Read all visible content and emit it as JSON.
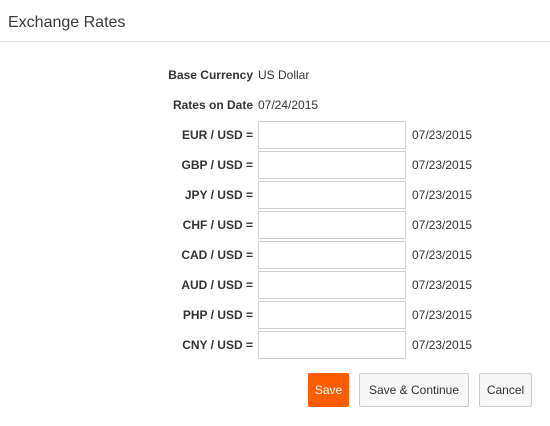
{
  "header": {
    "title": "Exchange Rates"
  },
  "info": {
    "base_currency_label": "Base Currency",
    "base_currency_value": "US Dollar",
    "rates_on_date_label": "Rates on Date",
    "rates_on_date_value": "07/24/2015"
  },
  "rates": [
    {
      "label": "EUR / USD =",
      "value": "",
      "date": "07/23/2015"
    },
    {
      "label": "GBP / USD =",
      "value": "",
      "date": "07/23/2015"
    },
    {
      "label": "JPY / USD =",
      "value": "",
      "date": "07/23/2015"
    },
    {
      "label": "CHF / USD =",
      "value": "",
      "date": "07/23/2015"
    },
    {
      "label": "CAD / USD =",
      "value": "",
      "date": "07/23/2015"
    },
    {
      "label": "AUD / USD =",
      "value": "",
      "date": "07/23/2015"
    },
    {
      "label": "PHP / USD =",
      "value": "",
      "date": "07/23/2015"
    },
    {
      "label": "CNY / USD =",
      "value": "",
      "date": "07/23/2015"
    }
  ],
  "buttons": {
    "save": "Save",
    "save_continue": "Save & Continue",
    "cancel": "Cancel"
  },
  "colors": {
    "accent": "#ff5c00",
    "divider": "#e2e2e2",
    "input_border": "#cfcfcf"
  }
}
